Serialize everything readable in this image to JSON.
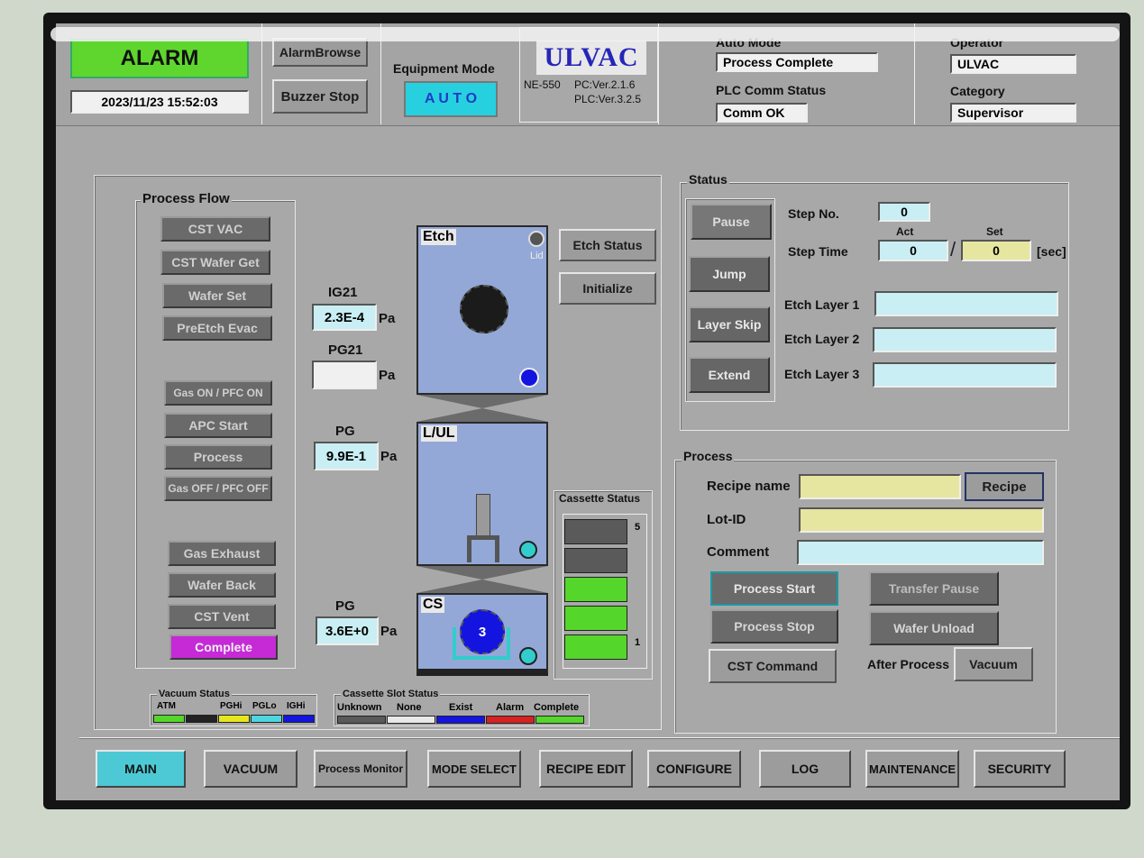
{
  "header": {
    "alarm_label": "ALARM",
    "datetime": "2023/11/23 15:52:03",
    "alarm_browse": "AlarmBrowse",
    "buzzer_stop": "Buzzer Stop",
    "equipment_mode_label": "Equipment Mode",
    "equipment_mode_value": "A U T O",
    "brand": "ULVAC",
    "model": "NE-550",
    "pc_ver": "PC:Ver.2.1.6",
    "plc_ver": "PLC:Ver.3.2.5",
    "auto_mode_label": "Auto Mode",
    "auto_mode_value": "Process Complete",
    "plc_comm_label": "PLC Comm Status",
    "plc_comm_value": "Comm OK",
    "operator_label": "Operator",
    "operator_value": "ULVAC",
    "category_label": "Category",
    "category_value": "Supervisor"
  },
  "process_flow": {
    "title": "Process Flow",
    "steps": [
      "CST VAC",
      "CST Wafer Get",
      "Wafer Set",
      "PreEtch Evac",
      "Gas ON / PFC ON",
      "APC Start",
      "Process",
      "Gas OFF / PFC OFF",
      "Gas Exhaust",
      "Wafer Back",
      "CST Vent",
      "Complete"
    ]
  },
  "gauges": {
    "ig21_label": "IG21",
    "ig21_value": "2.3E-4",
    "ig21_unit": "Pa",
    "pg21_label": "PG21",
    "pg21_value": "",
    "pg21_unit": "Pa",
    "pg_lul_label": "PG",
    "pg_lul_value": "9.9E-1",
    "pg_lul_unit": "Pa",
    "pg_cs_label": "PG",
    "pg_cs_value": "3.6E+0",
    "pg_cs_unit": "Pa"
  },
  "chambers": {
    "etch": "Etch",
    "lid": "Lid",
    "lul": "L/UL",
    "cs": "CS",
    "cs_wafer": "3"
  },
  "etch_buttons": {
    "etch_status": "Etch Status",
    "initialize": "Initialize"
  },
  "cassette_status": {
    "title": "Cassette Status",
    "top_num": "5",
    "bottom_num": "1"
  },
  "status_panel": {
    "title": "Status",
    "pause": "Pause",
    "jump": "Jump",
    "layer_skip": "Layer Skip",
    "extend": "Extend",
    "step_no_label": "Step No.",
    "step_no_value": "0",
    "act_label": "Act",
    "set_label": "Set",
    "step_time_label": "Step Time",
    "step_time_act": "0",
    "step_time_set": "0",
    "sec_label": "[sec]",
    "etch_layer_1_label": "Etch Layer 1",
    "etch_layer_1_value": "",
    "etch_layer_2_label": "Etch Layer 2",
    "etch_layer_2_value": "",
    "etch_layer_3_label": "Etch Layer 3",
    "etch_layer_3_value": ""
  },
  "process_panel": {
    "title": "Process",
    "recipe_name_label": "Recipe name",
    "recipe_name_value": "",
    "recipe_button": "Recipe",
    "lot_id_label": "Lot-ID",
    "lot_id_value": "",
    "comment_label": "Comment",
    "comment_value": "",
    "process_start": "Process Start",
    "transfer_pause": "Transfer Pause",
    "process_stop": "Process Stop",
    "wafer_unload": "Wafer Unload",
    "cst_command": "CST Command",
    "after_process_label": "After Process",
    "after_process_value": "Vacuum"
  },
  "vacuum_legend": {
    "title": "Vacuum Status",
    "items": [
      "ATM",
      "",
      "PGHi",
      "PGLo",
      "IGHi"
    ]
  },
  "slot_legend": {
    "title": "Cassette Slot Status",
    "items": [
      "Unknown",
      "None",
      "Exist",
      "Alarm",
      "Complete"
    ]
  },
  "nav": [
    "MAIN",
    "VACUUM",
    "Process Monitor",
    "MODE SELECT",
    "RECIPE EDIT",
    "CONFIGURE",
    "LOG",
    "MAINTENANCE",
    "SECURITY"
  ],
  "colors": {
    "alarm_green": "#5fd62e",
    "auto_cyan": "#27d0df",
    "complete_magenta": "#c52ad6",
    "cassette_exist": "#55d62a",
    "cassette_dark": "#5a5a5a",
    "wafer_blue": "#1414e0"
  }
}
